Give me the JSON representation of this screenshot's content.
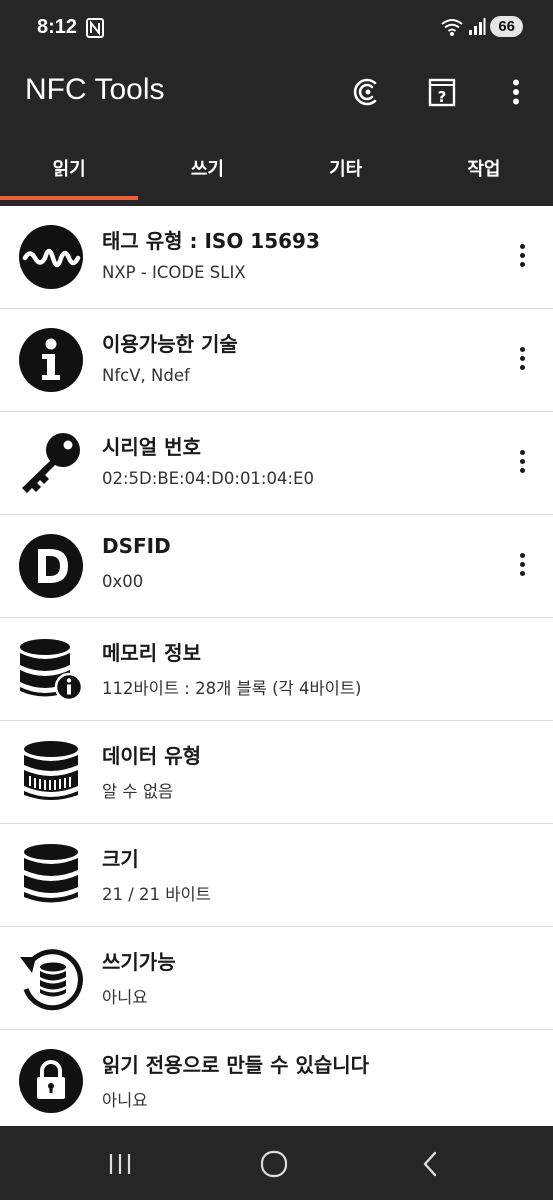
{
  "status_bar": {
    "time": "8:12",
    "battery": "66"
  },
  "app_bar": {
    "title": "NFC Tools"
  },
  "tabs": [
    {
      "label": "읽기",
      "active": true
    },
    {
      "label": "쓰기",
      "active": false
    },
    {
      "label": "기타",
      "active": false
    },
    {
      "label": "작업",
      "active": false
    }
  ],
  "items": [
    {
      "icon": "waveform-icon",
      "title": "태그 유형 : ISO 15693",
      "subtitle": "NXP - ICODE SLIX",
      "has_menu": true
    },
    {
      "icon": "info-icon",
      "title": "이용가능한 기술",
      "subtitle": "NfcV, Ndef",
      "has_menu": true
    },
    {
      "icon": "key-icon",
      "title": "시리얼 번호",
      "subtitle": "02:5D:BE:04:D0:01:04:E0",
      "has_menu": true
    },
    {
      "icon": "letter-d-icon",
      "title": "DSFID",
      "subtitle": "0x00",
      "has_menu": true
    },
    {
      "icon": "database-info-icon",
      "title": "메모리 정보",
      "subtitle": "112바이트 : 28개 블록 (각 4바이트)",
      "has_menu": false
    },
    {
      "icon": "database-icon",
      "title": "데이터 유형",
      "subtitle": "알 수 없음",
      "has_menu": false
    },
    {
      "icon": "database-stack-icon",
      "title": "크기",
      "subtitle": "21 / 21 바이트",
      "has_menu": false
    },
    {
      "icon": "database-refresh-icon",
      "title": "쓰기가능",
      "subtitle": "아니요",
      "has_menu": false
    },
    {
      "icon": "lock-icon",
      "title": "읽기 전용으로 만들 수 있습니다",
      "subtitle": "아니요",
      "has_menu": false
    }
  ],
  "colors": {
    "bar": "#262626",
    "accent": "#e8603c",
    "text": "#1a1a1a"
  }
}
